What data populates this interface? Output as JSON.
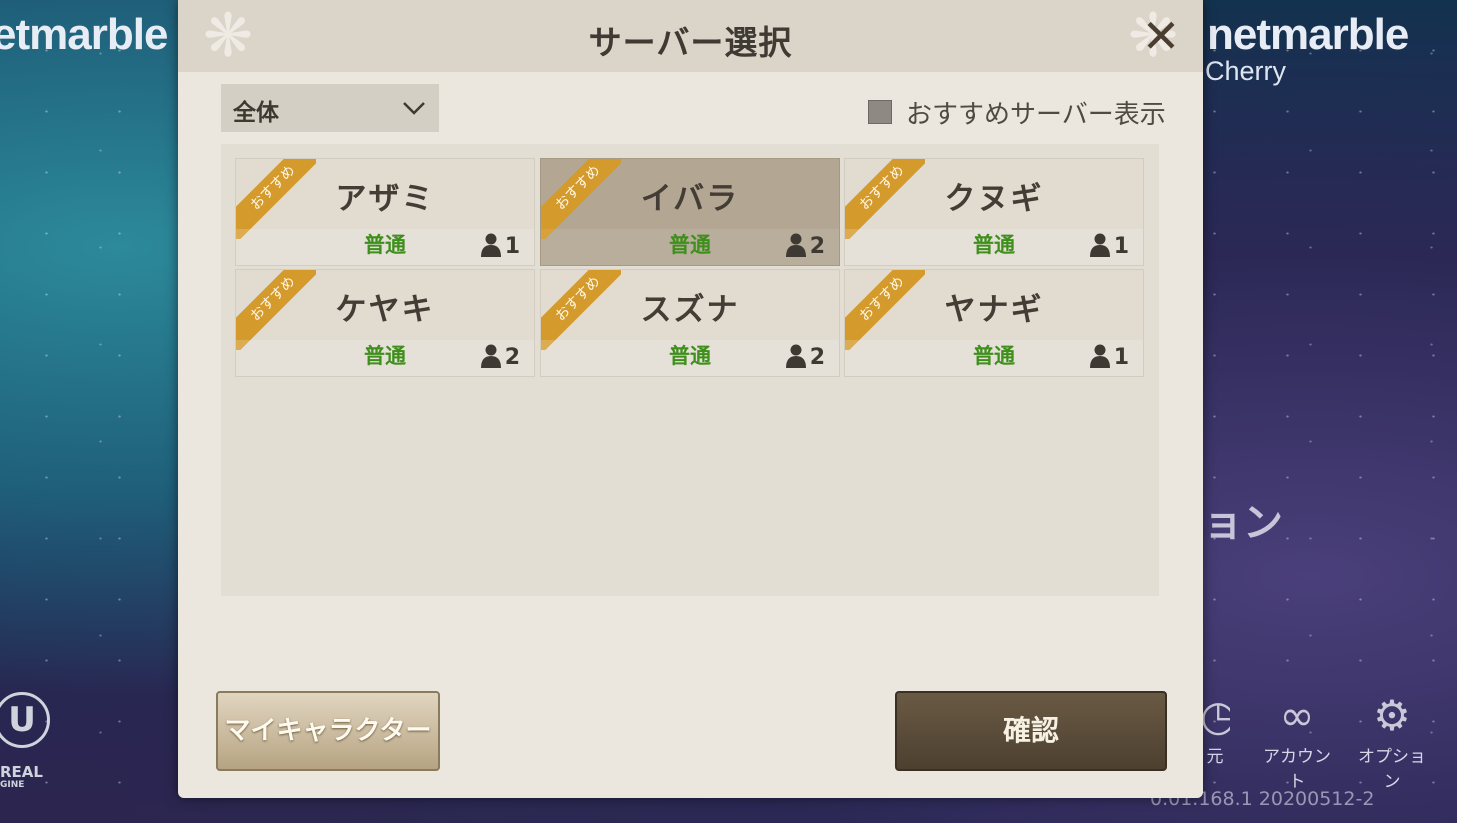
{
  "background": {
    "brand_left": "etmarble",
    "brand_right": "netmarble",
    "brand_sub": "Cherry",
    "game_title_partial": "ョン",
    "version": "0.01.168.1  20200512-2",
    "nav": {
      "back_label": "元",
      "account_label": "アカウント",
      "option_label": "オプション"
    },
    "ue_logo_text": "REAL",
    "ue_logo_sub": "GINE"
  },
  "dialog": {
    "title": "サーバー選択",
    "filter_value": "全体",
    "recommend_label": "おすすめサーバー表示",
    "recommend_checked": false,
    "ribbon_text": "おすすめ",
    "servers": [
      {
        "name": "アザミ",
        "status": "普通",
        "count": "1",
        "selected": false
      },
      {
        "name": "イバラ",
        "status": "普通",
        "count": "2",
        "selected": true
      },
      {
        "name": "クヌギ",
        "status": "普通",
        "count": "1",
        "selected": false
      },
      {
        "name": "ケヤキ",
        "status": "普通",
        "count": "2",
        "selected": false
      },
      {
        "name": "スズナ",
        "status": "普通",
        "count": "2",
        "selected": false
      },
      {
        "name": "ヤナギ",
        "status": "普通",
        "count": "1",
        "selected": false
      }
    ],
    "my_character_label": "マイキャラクター",
    "confirm_label": "確認"
  },
  "colors": {
    "status_green": "#3f8f1c",
    "ribbon_orange": "#d49a2c",
    "dialog_bg": "#ebe7de",
    "confirm_button": "#5a4b38"
  }
}
